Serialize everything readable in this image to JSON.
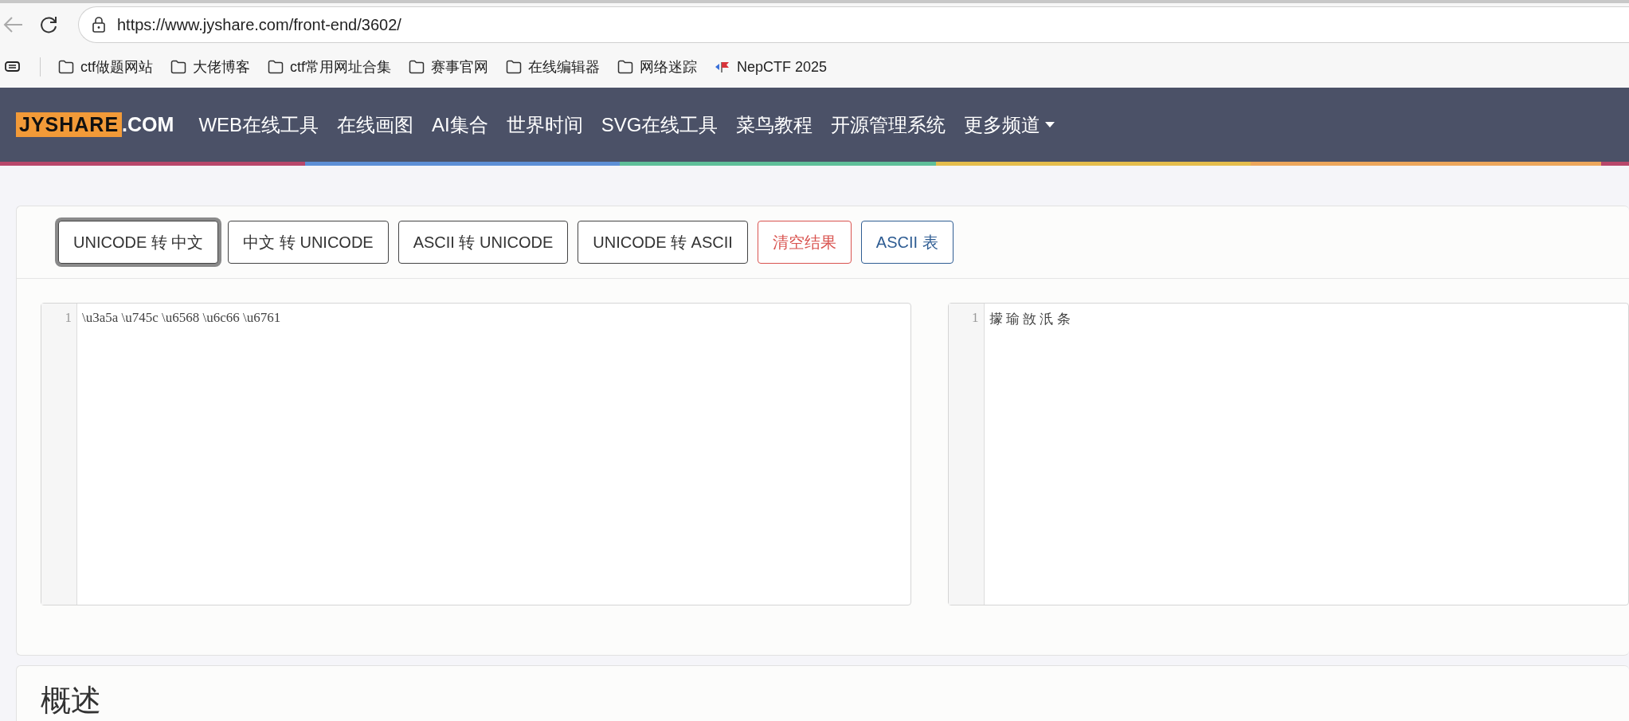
{
  "browser": {
    "url": "https://www.jyshare.com/front-end/3602/",
    "bookmarks": [
      {
        "label": "ctf做题网站",
        "kind": "folder"
      },
      {
        "label": "大佬博客",
        "kind": "folder"
      },
      {
        "label": "ctf常用网址合集",
        "kind": "folder"
      },
      {
        "label": "赛事官网",
        "kind": "folder"
      },
      {
        "label": "在线编辑器",
        "kind": "folder"
      },
      {
        "label": "网络迷踪",
        "kind": "folder"
      },
      {
        "label": "NepCTF 2025",
        "kind": "site"
      }
    ]
  },
  "navbar": {
    "logo": {
      "mark": "JYSHARE",
      "suffix": ".COM"
    },
    "items": [
      {
        "label": "WEB在线工具",
        "kind": "link"
      },
      {
        "label": "在线画图",
        "kind": "link"
      },
      {
        "label": "AI集合",
        "kind": "link"
      },
      {
        "label": "世界时间",
        "kind": "link"
      },
      {
        "label": "SVG在线工具",
        "kind": "link"
      },
      {
        "label": "菜鸟教程",
        "kind": "link"
      },
      {
        "label": "开源管理系统",
        "kind": "link"
      },
      {
        "label": "更多频道",
        "kind": "dropdown"
      }
    ]
  },
  "toolbar": {
    "buttons": [
      {
        "label": "UNICODE 转 中文",
        "kind": "default",
        "selected": true
      },
      {
        "label": "中文 转 UNICODE",
        "kind": "default",
        "selected": false
      },
      {
        "label": "ASCII 转 UNICODE",
        "kind": "default",
        "selected": false
      },
      {
        "label": "UNICODE 转 ASCII",
        "kind": "default",
        "selected": false
      },
      {
        "label": "清空结果",
        "kind": "danger",
        "selected": false
      },
      {
        "label": "ASCII 表",
        "kind": "info",
        "selected": false
      }
    ]
  },
  "editors": [
    {
      "line_number": "1",
      "text": "\\u3a5a \\u745c \\u6568 \\u6c66 \\u6761"
    },
    {
      "line_number": "1",
      "text": "㩚 瑜 敨 汦 条"
    }
  ],
  "section": {
    "title": "概述"
  }
}
